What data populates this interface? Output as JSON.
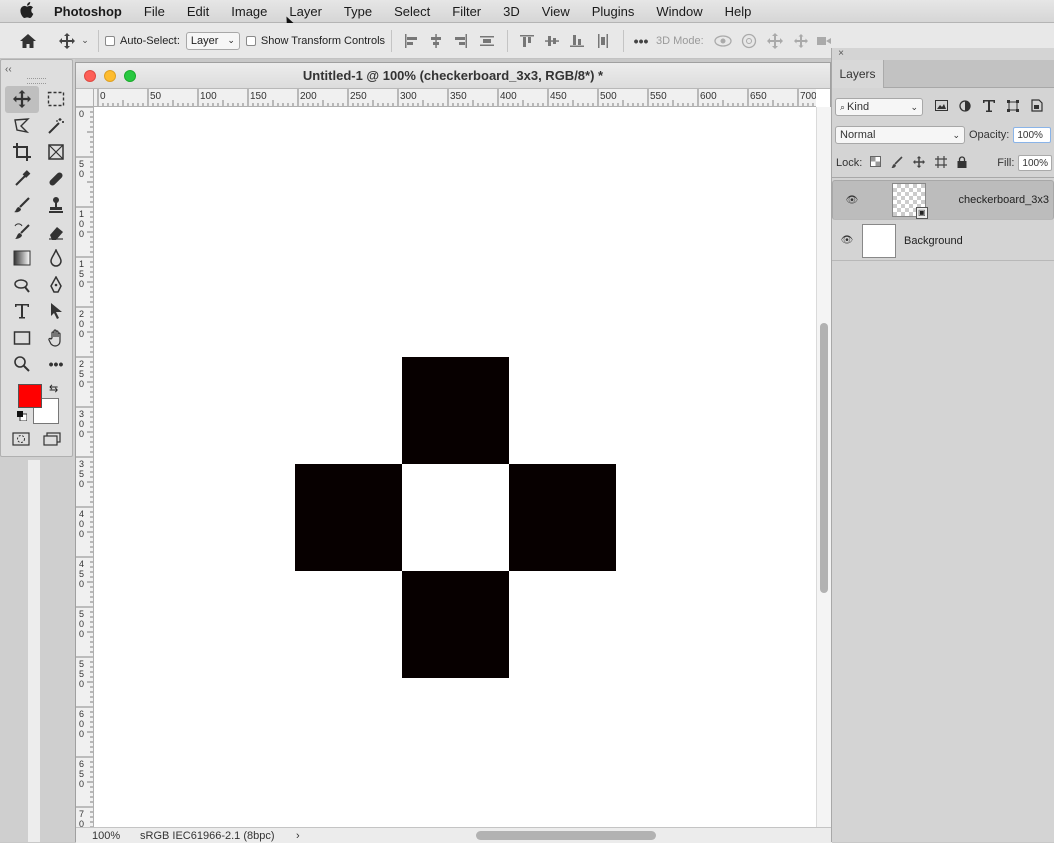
{
  "menubar": {
    "app": "Photoshop",
    "items": [
      "File",
      "Edit",
      "Image",
      "Layer",
      "Type",
      "Select",
      "Filter",
      "3D",
      "View",
      "Plugins",
      "Window",
      "Help"
    ]
  },
  "options": {
    "auto_select_label": "Auto-Select:",
    "auto_select_value": "Layer",
    "show_transform_label": "Show Transform Controls",
    "mode_3d_label": "3D Mode:"
  },
  "toolbar": {
    "collapse_glyph": "‹‹",
    "foreground_color": "#ff0000",
    "background_color": "#ffffff"
  },
  "document": {
    "title": "Untitled-1 @ 100% (checkerboard_3x3, RGB/8*) *",
    "zoom": "100%",
    "profile": "sRGB IEC61966-2.1 (8bpc)",
    "status_arrow": "›",
    "ruler_h": [
      "0",
      "50",
      "100",
      "150",
      "200",
      "250",
      "300",
      "350",
      "400",
      "450",
      "500",
      "550",
      "600",
      "650",
      "700"
    ],
    "ruler_v": [
      "0",
      "5 0",
      "1 0 0",
      "1 5 0",
      "2 0 0",
      "2 5 0",
      "3 0 0",
      "3 5 0",
      "4 0 0",
      "4 5 0",
      "5 0 0",
      "5 5 0",
      "6 0 0",
      "6 5 0",
      "7 0 0"
    ]
  },
  "layers_panel": {
    "close_glyph": "×",
    "tab": "Layers",
    "filter_kind": "Kind",
    "blend_mode": "Normal",
    "opacity_label": "Opacity:",
    "opacity": "100%",
    "lock_label": "Lock:",
    "fill_label": "Fill:",
    "fill": "100%",
    "layers": [
      {
        "name": "checkerboard_3x3",
        "selected": true
      },
      {
        "name": "Background",
        "selected": false
      }
    ]
  }
}
